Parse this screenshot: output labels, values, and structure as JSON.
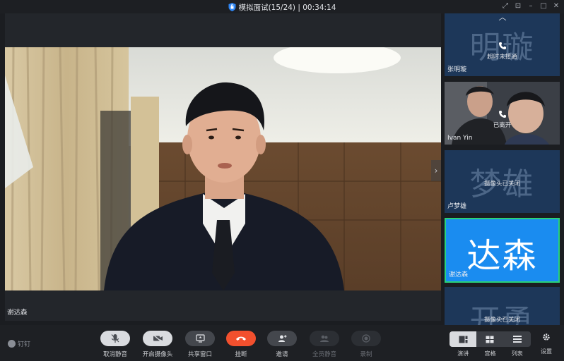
{
  "window": {
    "title": "模拟面试(15/24) | 00:34:14"
  },
  "stage": {
    "speaker_name": "谢达森"
  },
  "participants": [
    {
      "big_name": "明璇",
      "name": "张明璇",
      "status": "超时未接通",
      "icon": "phone-icon"
    },
    {
      "big_name": "",
      "name": "Ivan Yin",
      "status": "已离开",
      "icon": "phone-icon"
    },
    {
      "big_name": "梦雄",
      "name": "卢梦雄",
      "status": "摄像头已关闭",
      "icon": ""
    },
    {
      "big_name": "达森",
      "name": "谢达森",
      "status": "",
      "icon": ""
    },
    {
      "big_name": "开勇",
      "name": "",
      "status": "摄像头已关闭",
      "icon": ""
    }
  ],
  "toolbar": {
    "brand": "钉钉",
    "buttons": [
      {
        "label": "取消静音",
        "icon": "microphone-icon"
      },
      {
        "label": "开启摄像头",
        "icon": "camera-icon"
      },
      {
        "label": "共享窗口",
        "icon": "share-window-icon"
      },
      {
        "label": "挂断",
        "icon": "hang-up-icon"
      },
      {
        "label": "邀请",
        "icon": "invite-icon"
      },
      {
        "label": "全员静音",
        "icon": "mute-all-icon"
      },
      {
        "label": "录制",
        "icon": "record-icon"
      }
    ],
    "layouts": [
      {
        "label": "演讲",
        "icon": "speaker-layout-icon",
        "selected": true
      },
      {
        "label": "宫格",
        "icon": "grid-layout-icon",
        "selected": false
      },
      {
        "label": "列表",
        "icon": "list-layout-icon",
        "selected": false
      }
    ],
    "settings_label": "设置"
  },
  "colors": {
    "accent_blue": "#1a8cf0",
    "active_border": "#29d27a",
    "hangup_red": "#f2502e",
    "tile_bg": "#1d3759"
  }
}
